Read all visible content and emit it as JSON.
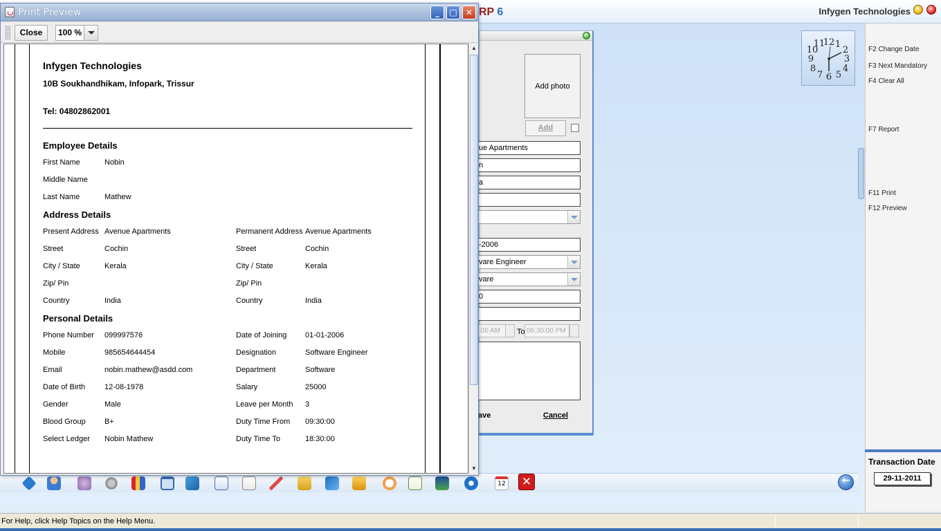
{
  "app": {
    "title_fragment": "RP",
    "title_number": "6",
    "company": "Infygen Technologies"
  },
  "function_keys": [
    "F2 Change Date",
    "F3 Next Mandatory",
    "F4 Clear All",
    "F7 Report",
    "F11 Print",
    "F12 Preview"
  ],
  "transaction": {
    "label": "Transaction Date",
    "date": "29-11-2011"
  },
  "status_bar": {
    "text": "For Help, click Help Topics on the Help Menu."
  },
  "employee_form": {
    "photo_label": "Add photo",
    "add_label": "Add",
    "fields": [
      "ue Apartments",
      "n",
      "a",
      "",
      "",
      "-2006",
      "vare Engineer",
      "vare",
      "0",
      ""
    ],
    "time_from": ":00 AM",
    "to_label": "To",
    "time_to": "06:30:00 PM",
    "save_label": "ave",
    "cancel_label": "Cancel"
  },
  "print_preview": {
    "window_title": "Print Preview",
    "close_label": "Close",
    "zoom": "100 %",
    "report": {
      "company": "Infygen Technologies",
      "address": "10B Soukhandhikam, Infopark, Trissur",
      "tel": "Tel: 04802862001",
      "employee_title": "Employee Details",
      "employee": [
        {
          "label": "First Name",
          "value": "Nobin"
        },
        {
          "label": "Middle Name",
          "value": ""
        },
        {
          "label": "Last Name",
          "value": "Mathew"
        }
      ],
      "address_title": "Address Details",
      "address_left": [
        {
          "label": "Present Address",
          "value": "Avenue Apartments"
        },
        {
          "label": "Street",
          "value": "Cochin"
        },
        {
          "label": "City / State",
          "value": "Kerala"
        },
        {
          "label": "Zip/ Pin",
          "value": ""
        },
        {
          "label": "Country",
          "value": "India"
        }
      ],
      "address_right": [
        {
          "label": "Permanent Address",
          "value": "Avenue Apartments"
        },
        {
          "label": "Street",
          "value": "Cochin"
        },
        {
          "label": "City / State",
          "value": "Kerala"
        },
        {
          "label": "Zip/ Pin",
          "value": ""
        },
        {
          "label": "Country",
          "value": "India"
        }
      ],
      "personal_title": "Personal Details",
      "personal_left": [
        {
          "label": "Phone Number",
          "value": "099997576"
        },
        {
          "label": "Mobile",
          "value": "985654644454"
        },
        {
          "label": "Email",
          "value": "nobin.mathew@asdd.com"
        },
        {
          "label": "Date of Birth",
          "value": "12-08-1978"
        },
        {
          "label": "Gender",
          "value": "Male"
        },
        {
          "label": "Blood Group",
          "value": "B+"
        },
        {
          "label": "Select Ledger",
          "value": "Nobin Mathew"
        }
      ],
      "personal_right": [
        {
          "label": "Date of Joining",
          "value": "01-01-2006"
        },
        {
          "label": "Designation",
          "value": "Software Engineer"
        },
        {
          "label": "Department",
          "value": "Software"
        },
        {
          "label": "Salary",
          "value": "25000"
        },
        {
          "label": "Leave per Month",
          "value": "3"
        },
        {
          "label": "Duty Time From",
          "value": " 09:30:00"
        },
        {
          "label": "Duty Time To",
          "value": " 18:30:00"
        }
      ]
    }
  },
  "icons": {
    "toolbar": [
      "ledger-icon",
      "users-icon",
      "tools-icon",
      "settings-icon",
      "books-icon",
      "cart-icon",
      "transfer-icon",
      "document-icon",
      "report-icon",
      "chart-icon",
      "tree-icon",
      "sync-icon",
      "package-icon",
      "lifebuoy-icon",
      "checklist-icon",
      "calendar-check-icon",
      "gear-icon",
      "calendar-icon",
      "exit-icon"
    ],
    "back": "back-arrow-icon"
  },
  "calendar_day": "12"
}
